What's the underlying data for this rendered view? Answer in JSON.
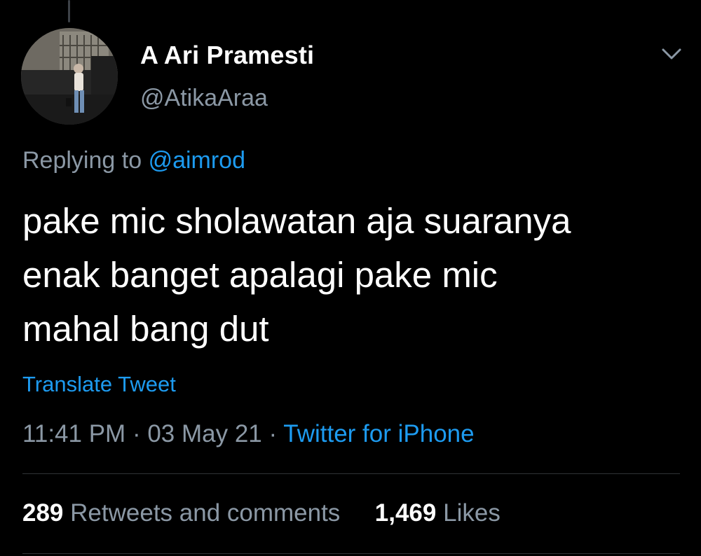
{
  "tweet": {
    "display_name": "A Ari Pramesti",
    "handle": "@AtikaAraa",
    "replying_prefix": "Replying to",
    "replying_to": "@aimrod",
    "text_lines": [
      "pake mic sholawatan aja suaranya",
      "enak banget apalagi pake mic",
      "mahal bang dut"
    ],
    "translate_label": "Translate Tweet",
    "time": "11:41 PM",
    "separator": "·",
    "date": "03 May 21",
    "source": "Twitter for iPhone"
  },
  "stats": {
    "retweets_count": "289",
    "retweets_label": "Retweets and comments",
    "likes_count": "1,469",
    "likes_label": "Likes"
  },
  "icons": {
    "menu": "chevron-down-icon"
  },
  "colors": {
    "background": "#000000",
    "primary_text": "#ffffff",
    "secondary_text": "#8b98a5",
    "link": "#1d9bf0",
    "divider": "#2f3336"
  }
}
